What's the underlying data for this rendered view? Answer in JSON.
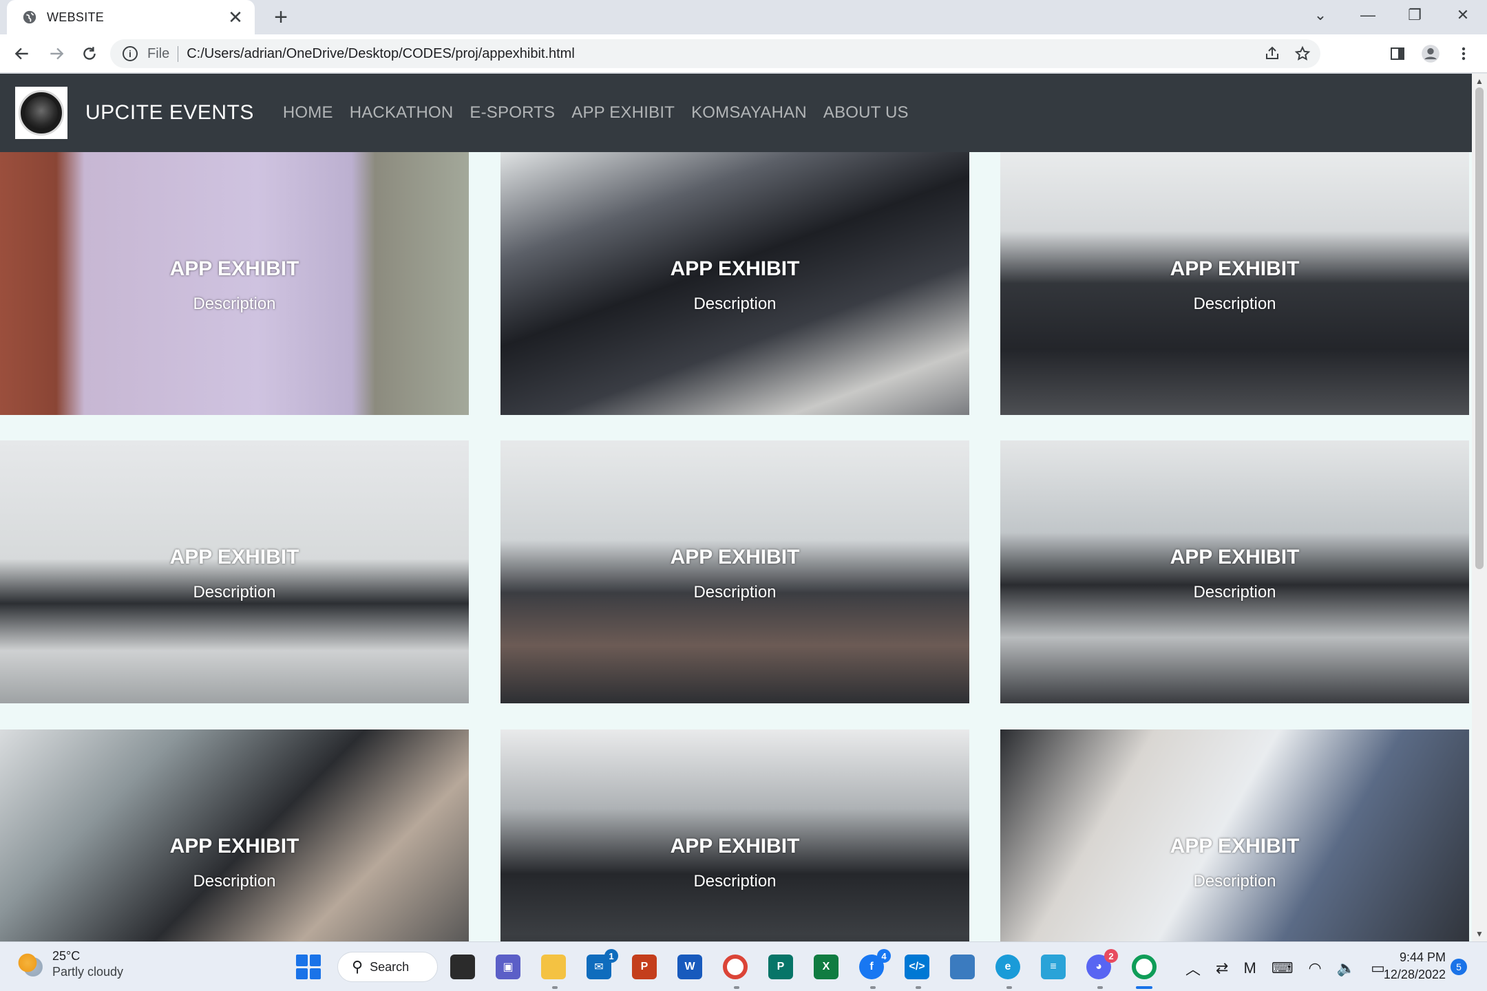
{
  "browser": {
    "tab_title": "WEBSITE",
    "tab_close": "✕",
    "new_tab": "+",
    "window_controls": [
      "⌄",
      "—",
      "❐",
      "✕"
    ],
    "scheme_label": "File",
    "url": "C:/Users/adrian/OneDrive/Desktop/CODES/proj/appexhibit.html"
  },
  "site": {
    "brand": "UPCITE EVENTS",
    "nav": [
      "HOME",
      "HACKATHON",
      "E-SPORTS",
      "APP EXHIBIT",
      "KOMSAYAHAN",
      "ABOUT US"
    ]
  },
  "cards": [
    {
      "title": "APP EXHIBIT",
      "description": "Description"
    },
    {
      "title": "APP EXHIBIT",
      "description": "Description"
    },
    {
      "title": "APP EXHIBIT",
      "description": "Description"
    },
    {
      "title": "APP EXHIBIT",
      "description": "Description"
    },
    {
      "title": "APP EXHIBIT",
      "description": "Description"
    },
    {
      "title": "APP EXHIBIT",
      "description": "Description"
    },
    {
      "title": "APP EXHIBIT",
      "description": "Description"
    },
    {
      "title": "APP EXHIBIT",
      "description": "Description"
    },
    {
      "title": "APP EXHIBIT",
      "description": "Description"
    }
  ],
  "taskbar": {
    "weather_temp": "25°C",
    "weather_condition": "Partly cloudy",
    "search_label": "Search",
    "badges": {
      "mail": "1",
      "facebook": "4",
      "discord": "2"
    },
    "time": "9:44 PM",
    "date": "12/28/2022",
    "notifications": "5"
  },
  "colors": {
    "navbar": "#343a40",
    "page_bg": "#eef9f8",
    "accent": "#1a73e8"
  }
}
